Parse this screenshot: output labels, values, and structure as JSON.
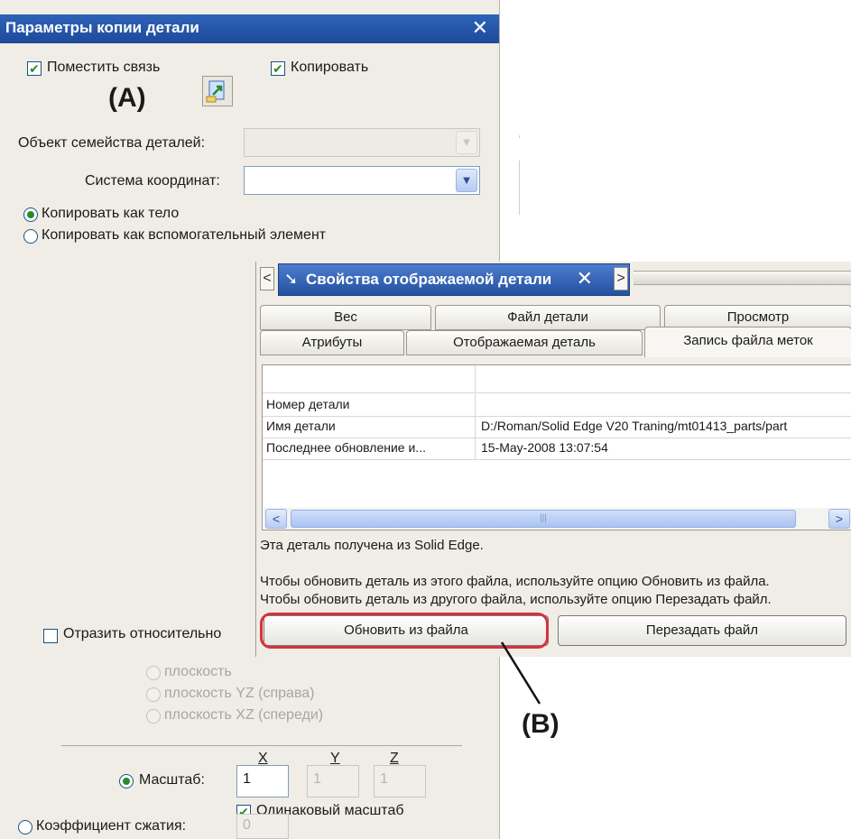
{
  "left_panel": {
    "title": "Параметры копии детали",
    "close_glyph": "✕",
    "place_link": {
      "label": "Поместить связь",
      "checked": true
    },
    "copy": {
      "label": "Копировать",
      "checked": true
    },
    "annotation_a": "(A)",
    "family_member": {
      "label": "Объект семейства деталей:",
      "value": ""
    },
    "coord_system": {
      "label": "Система координат:",
      "value": ""
    },
    "copy_as_body": {
      "label": "Копировать как тело",
      "selected": true
    },
    "copy_as_construction": {
      "label": "Копировать как вспомогательный элемент",
      "selected": false
    },
    "mirror": {
      "label": "Отразить относительно",
      "checked": false
    },
    "planes": [
      {
        "label": "плоскость"
      },
      {
        "label": "плоскость YZ (справа)"
      },
      {
        "label": "плоскость XZ (спереди)"
      }
    ],
    "axes": [
      "X",
      "Y",
      "Z"
    ],
    "scale": {
      "label": "Масштаб:",
      "selected": true,
      "x": "1",
      "y": "1",
      "z": "1"
    },
    "uniform_scale": {
      "label": "Одинаковый масштаб",
      "checked": true
    },
    "shrink": {
      "label": "Коэффициент сжатия:",
      "selected": false,
      "value": "0"
    }
  },
  "right_panel": {
    "title": "Свойства отображаемой детали",
    "close_glyph": "✕",
    "pin_icon": "pin-icon",
    "nav_prev": "<",
    "nav_next": ">",
    "tabs_row1": [
      "Вес",
      "Файл детали",
      "Просмотр"
    ],
    "tabs_row2": [
      "Атрибуты",
      "Отображаемая деталь",
      "Запись файла меток"
    ],
    "active_tab": "Запись файла меток",
    "grid": {
      "rows": [
        {
          "name": "Номер детали",
          "value": ""
        },
        {
          "name": "Имя детали",
          "value": "D:/Roman/Solid Edge V20 Traning/mt01413_parts/part"
        },
        {
          "name": "Последнее обновление и...",
          "value": "15-May-2008 13:07:54"
        }
      ],
      "scroll_left": "<",
      "scroll_right": ">"
    },
    "source_text": "Эта деталь получена из Solid Edge.",
    "hint_line1": "Чтобы обновить деталь из этого файла, используйте опцию Обновить из файла.",
    "hint_line2": "Чтобы обновить деталь из другого файла, используйте опцию Перезадать файл.",
    "update_button": "Обновить из файла",
    "reassign_button": "Перезадать файл"
  },
  "annotation_b": "(B)",
  "colors": {
    "highlight": "#d8323d",
    "title_blue": "#24509f",
    "check_green": "#2b8a2b"
  }
}
